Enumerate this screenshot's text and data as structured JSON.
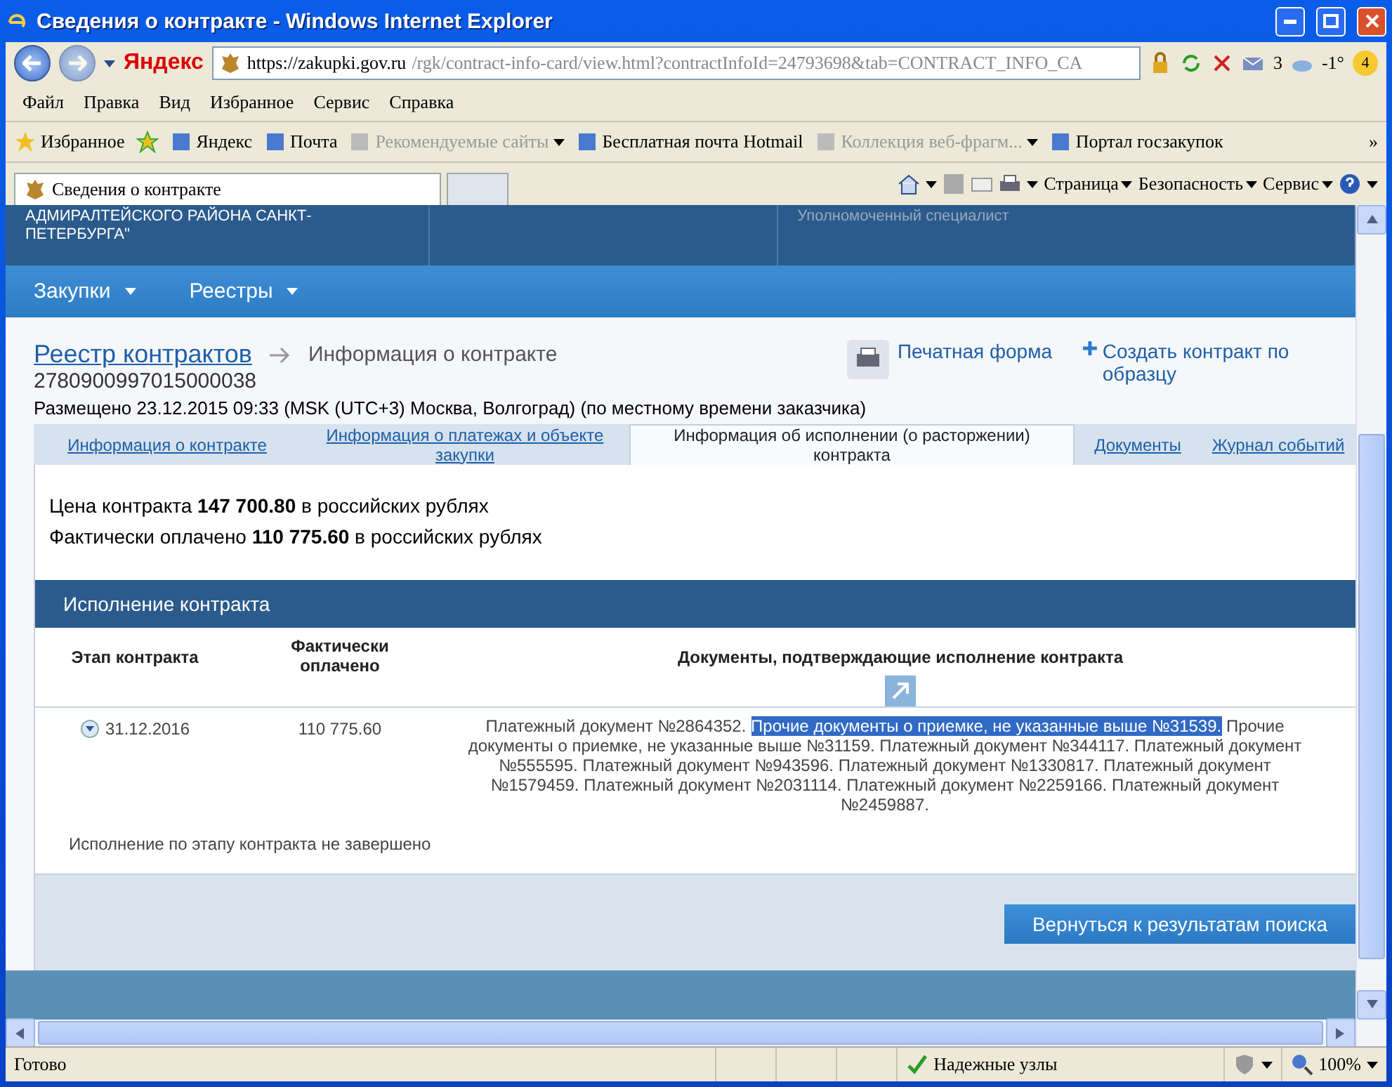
{
  "window": {
    "title": "Сведения о контракте - Windows Internet Explorer"
  },
  "address_bar": {
    "brand": "Яндекс",
    "url_host": "https://zakupki.gov.ru",
    "url_path": "/rgk/contract-info-card/view.html?contractInfoId=24793698&tab=CONTRACT_INFO_CA",
    "mail_count": "3",
    "weather": "-1°",
    "badge": "4"
  },
  "menu": [
    "Файл",
    "Правка",
    "Вид",
    "Избранное",
    "Сервис",
    "Справка"
  ],
  "favorites_bar": {
    "label": "Избранное",
    "items": [
      {
        "label": "Яндекс",
        "disabled": false,
        "dropdown": false
      },
      {
        "label": "Почта",
        "disabled": false,
        "dropdown": false
      },
      {
        "label": "Рекомендуемые сайты",
        "disabled": true,
        "dropdown": true
      },
      {
        "label": "Бесплатная почта Hotmail",
        "disabled": false,
        "dropdown": false
      },
      {
        "label": "Коллекция веб-фрагм...",
        "disabled": true,
        "dropdown": true
      },
      {
        "label": "Портал госзакупок",
        "disabled": false,
        "dropdown": false
      }
    ],
    "more": "»"
  },
  "browser_tabs": [
    {
      "label": "Сведения о контракте",
      "selected": true
    }
  ],
  "command_bar": [
    "Страница",
    "Безопасность",
    "Сервис"
  ],
  "page": {
    "header": {
      "org": "АДМИРАЛТЕЙСКОГО РАЙОНА САНКТ-ПЕТЕРБУРГА\"",
      "role": "Уполномоченный специалист"
    },
    "nav": [
      "Закупки",
      "Реестры"
    ],
    "breadcrumb": {
      "link": "Реестр контрактов",
      "current": "Информация о контракте"
    },
    "contract_number": "2780900997015000038",
    "print_link": "Печатная форма",
    "create_link": "Создать контракт по образцу",
    "posted": "Размещено 23.12.2015 09:33 (MSK (UTC+3) Москва, Волгоград) (по местному времени заказчика)",
    "tabs": [
      {
        "label": "Информация о контракте",
        "selected": false
      },
      {
        "label": "Информация о платежах и объекте закупки",
        "selected": false
      },
      {
        "label": "Информация об исполнении (о расторжении) контракта",
        "selected": true
      },
      {
        "label": "Документы",
        "selected": false
      },
      {
        "label": "Журнал событий",
        "selected": false
      }
    ],
    "summary": [
      "Цена контракта **147 700.80** в российских рублях",
      "Фактически оплачено **110 775.60** в российских рублях"
    ],
    "section_title": "Исполнение контракта",
    "table": {
      "columns": [
        "Этап контракта",
        "Фактически оплачено",
        "Документы, подтверждающие исполнение контракта"
      ],
      "rows": [
        {
          "stage": "31.12.2016",
          "paid": "110 775.60",
          "documents": [
            {
              "text": "Платежный документ №2864352. ",
              "highlighted": false
            },
            {
              "text": "Прочие документы о приемке, не указанные выше №31539.",
              "highlighted": true
            },
            {
              "text": " Прочие документы о приемке, не указанные выше №31159. Платежный документ №344117. Платежный документ №555595. Платежный документ №943596. Платежный документ №1330817. Платежный документ №1579459. Платежный документ №2031114. Платежный документ №2259166. Платежный документ №2459887.",
              "highlighted": false
            }
          ],
          "note": "Исполнение по этапу контракта не завершено"
        }
      ]
    },
    "back_button": "Вернуться к результатам поиска"
  },
  "status_bar": {
    "text": "Готово",
    "zone": "Надежные узлы",
    "zoom": "100%"
  }
}
